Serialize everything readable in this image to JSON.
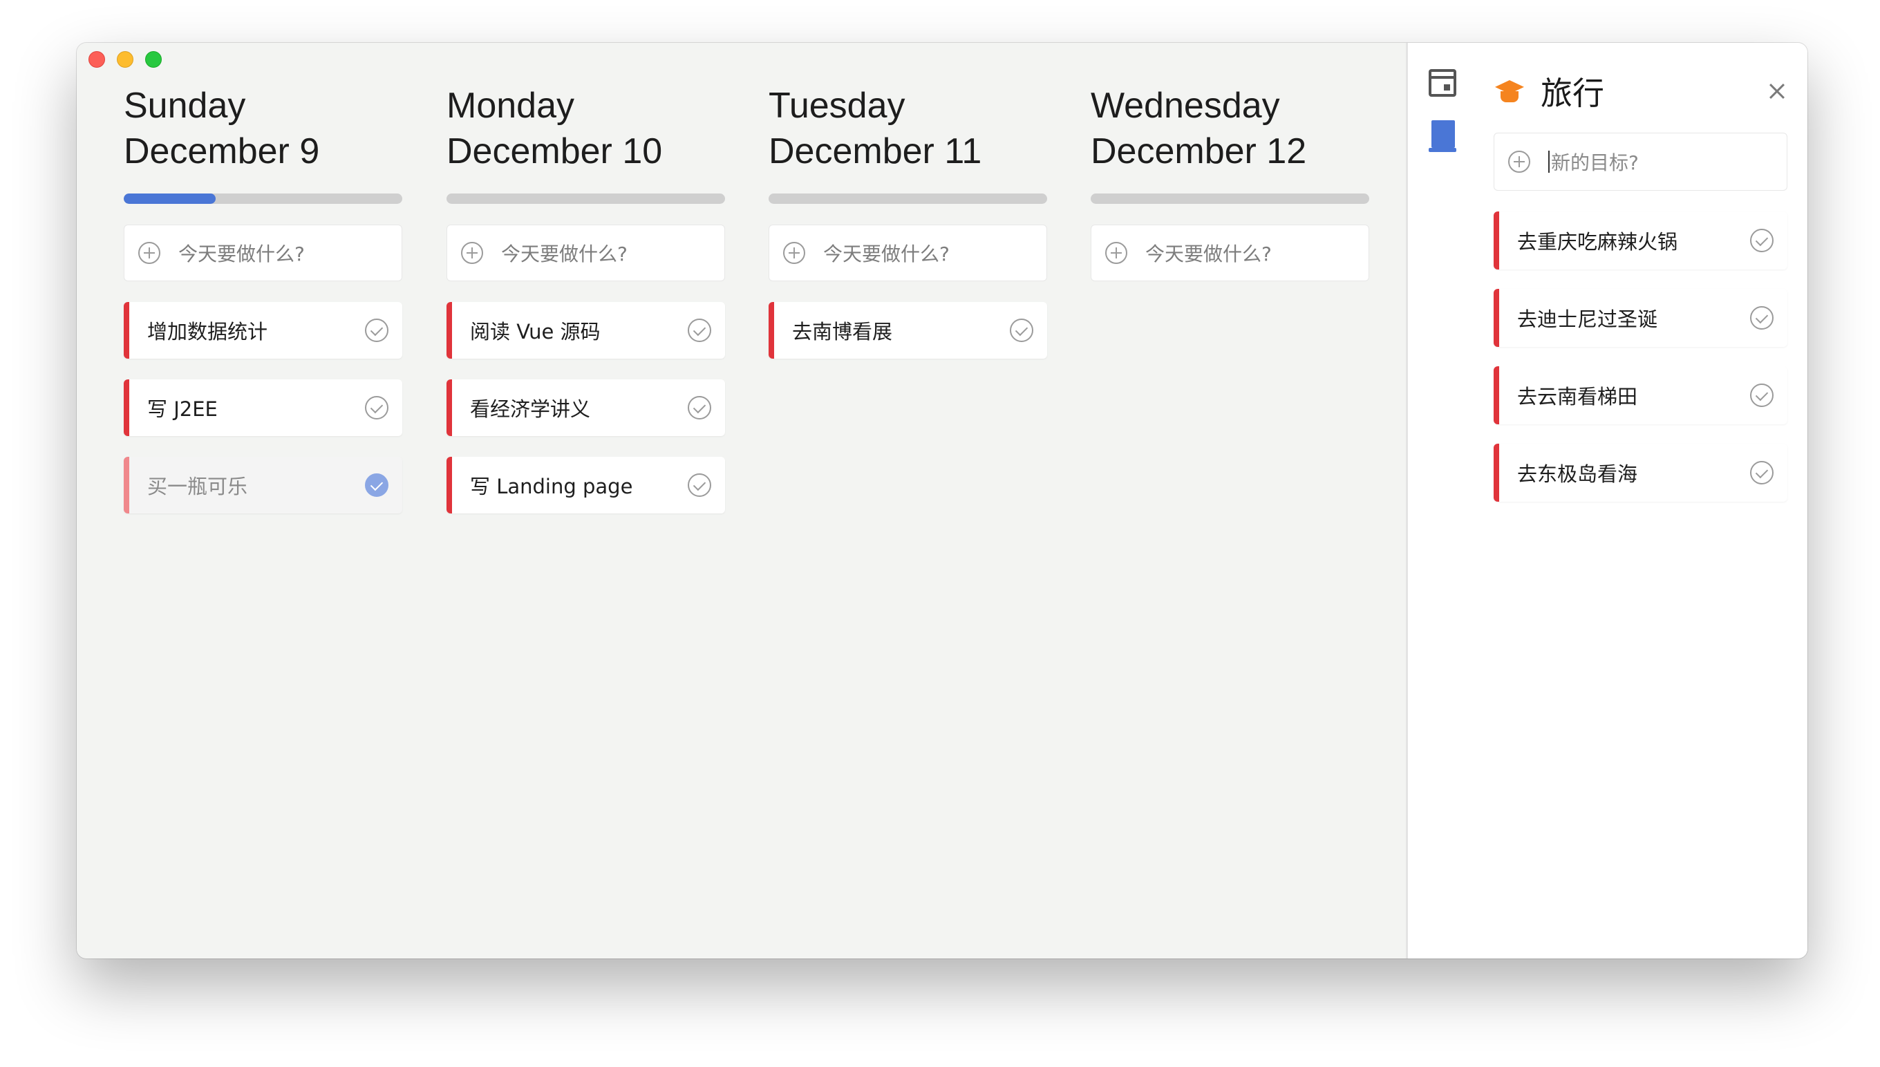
{
  "window": {
    "traffic_lights": [
      "close",
      "minimize",
      "zoom"
    ]
  },
  "days": [
    {
      "weekday": "Sunday",
      "date": "December 9",
      "progress": 0.33,
      "add_placeholder": "今天要做什么?",
      "tasks": [
        {
          "label": "增加数据统计",
          "done": false
        },
        {
          "label": "写 J2EE",
          "done": false
        },
        {
          "label": "买一瓶可乐",
          "done": true
        }
      ]
    },
    {
      "weekday": "Monday",
      "date": "December 10",
      "progress": 0,
      "add_placeholder": "今天要做什么?",
      "tasks": [
        {
          "label": "阅读 Vue 源码",
          "done": false
        },
        {
          "label": "看经济学讲义",
          "done": false
        },
        {
          "label": "写 Landing page",
          "done": false
        }
      ]
    },
    {
      "weekday": "Tuesday",
      "date": "December 11",
      "progress": 0,
      "add_placeholder": "今天要做什么?",
      "tasks": [
        {
          "label": "去南博看展",
          "done": false
        }
      ]
    },
    {
      "weekday": "Wednesday",
      "date": "December 12",
      "progress": 0,
      "add_placeholder": "今天要做什么?",
      "tasks": []
    }
  ],
  "sidebar": {
    "icons": [
      "calendar-icon",
      "book-icon"
    ],
    "goal": {
      "icon": "graduation-cap-icon",
      "title": "旅行",
      "add_placeholder": "新的目标?",
      "items": [
        {
          "label": "去重庆吃麻辣火锅",
          "done": false
        },
        {
          "label": "去迪士尼过圣诞",
          "done": false
        },
        {
          "label": "去云南看梯田",
          "done": false
        },
        {
          "label": "去东极岛看海",
          "done": false
        }
      ]
    }
  },
  "colors": {
    "accent_blue": "#4a76d6",
    "task_red": "#e0343b",
    "goal_orange": "#f5841f"
  }
}
